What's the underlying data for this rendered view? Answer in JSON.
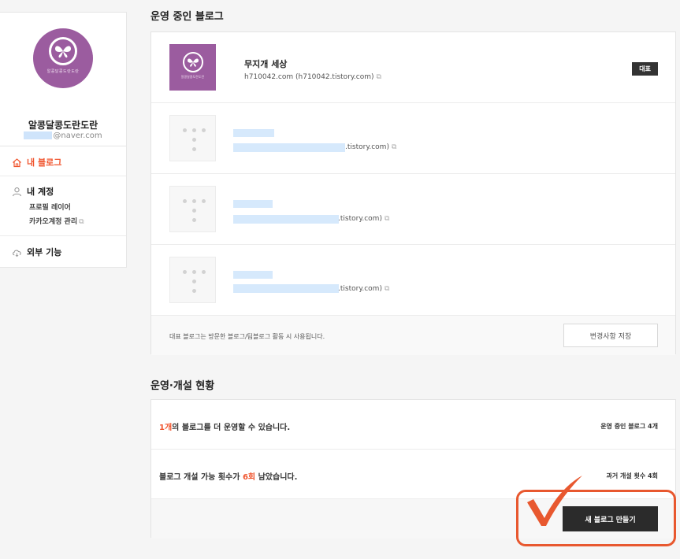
{
  "profile": {
    "avatar_caption": "알콩달콩도란도란",
    "nickname": "알콩달콩도란도란",
    "email_domain": "@naver.com"
  },
  "menu": {
    "my_blog": "내 블로그",
    "my_account": "내 계정",
    "profile_layer": "프로필 레이어",
    "kakao_account": "카카오계정 관리",
    "external": "외부 기능"
  },
  "blogs": {
    "section_title": "운영 중인 블로그",
    "main": {
      "name": "무지개 세상",
      "url": "h710042.com (h710042.tistory.com)",
      "thumb_caption": "알콩달콩도란도란",
      "badge": "대표"
    },
    "others": [
      {
        "url_suffix": ".tistory.com)"
      },
      {
        "url_suffix": ".tistory.com)"
      },
      {
        "url_suffix": ".tistory.com)"
      }
    ],
    "footer_note": "대표 블로그는 방문한 블로그/팀블로그 활동 시 사용됩니다.",
    "save_label": "변경사항 저장"
  },
  "status": {
    "section_title": "운영·개설 현황",
    "row1": {
      "highlight": "1개",
      "text": "의 블로그를 더 운영할 수 있습니다.",
      "right": "운영 중인 블로그 4개"
    },
    "row2": {
      "text_before": "블로그 개설 가능 횟수가 ",
      "highlight": "6회",
      "text_after": " 남았습니다.",
      "right": "과거 개설 횟수 4회"
    },
    "create_label": "새 블로그 만들기"
  },
  "colors": {
    "accent": "#f0542d",
    "brand_purple": "#9b5c9f",
    "annotation": "#e8582f"
  },
  "icons": {
    "home": "home-icon",
    "user": "user-icon",
    "cloud": "cloud-icon",
    "external": "external-link-icon",
    "butterfly": "butterfly-icon",
    "check": "check-mark-icon"
  }
}
